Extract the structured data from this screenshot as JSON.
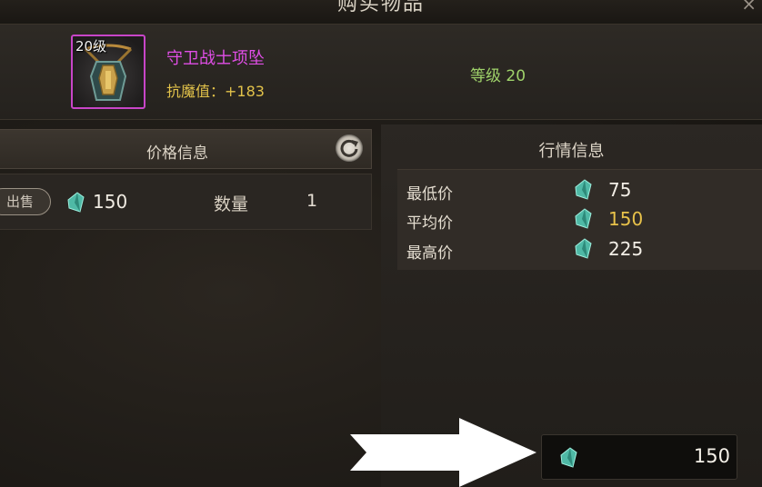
{
  "window": {
    "title": "购买物品",
    "close_glyph": "×"
  },
  "item": {
    "level_badge": "20级",
    "name": "守卫战士项坠",
    "stat": "抗魔值：+183",
    "requirement": "等级 20",
    "rarity_color": "#c845c8"
  },
  "price_panel": {
    "header": "价格信息",
    "refresh_icon": "refresh-icon",
    "sell_button": "出售",
    "price": "150",
    "quantity_label": "数量",
    "quantity": "1"
  },
  "market_panel": {
    "header": "行情信息",
    "rows": [
      {
        "label": "最低价",
        "value": "75"
      },
      {
        "label": "平均价",
        "value": "150"
      },
      {
        "label": "最高价",
        "value": "225"
      }
    ]
  },
  "total": {
    "value": "150",
    "currency_icon": "crystal-icon"
  },
  "colors": {
    "average_price": "#e8c24a",
    "requirement_ok": "#9fd26a",
    "item_name": "#e04ee6"
  }
}
